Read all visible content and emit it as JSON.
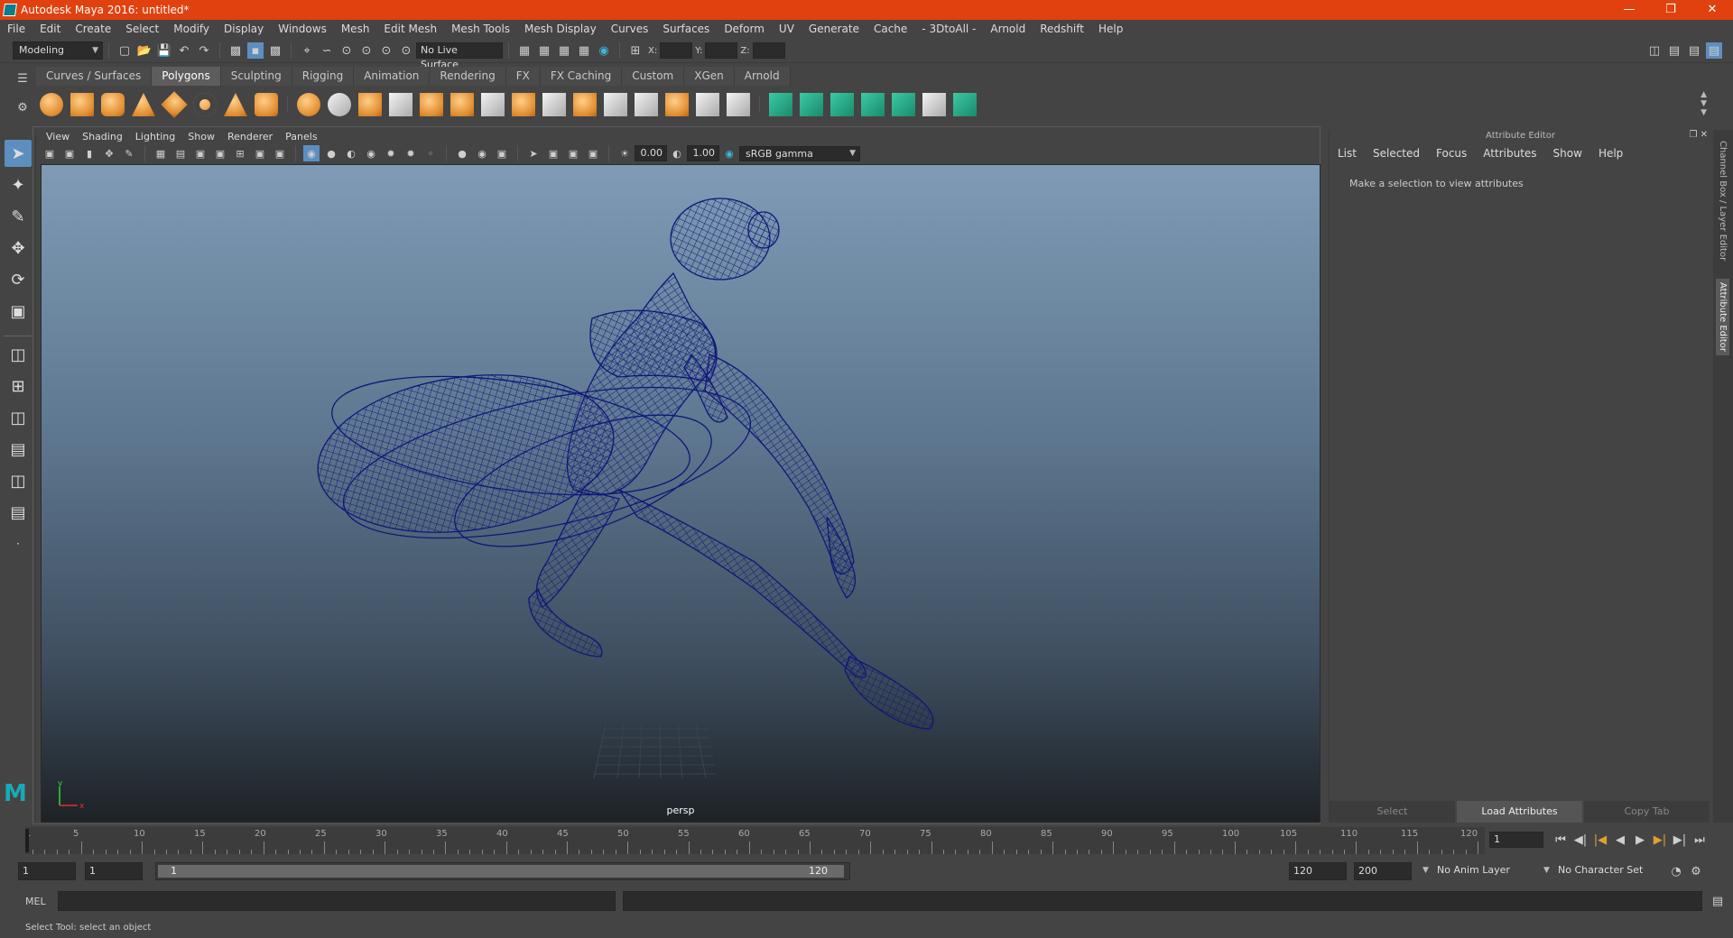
{
  "titlebar": {
    "title": "Autodesk Maya 2016: untitled*"
  },
  "menubar": {
    "items": [
      "File",
      "Edit",
      "Create",
      "Select",
      "Modify",
      "Display",
      "Windows",
      "Mesh",
      "Edit Mesh",
      "Mesh Tools",
      "Mesh Display",
      "Curves",
      "Surfaces",
      "Deform",
      "UV",
      "Generate",
      "Cache",
      "- 3DtoAll -",
      "Arnold",
      "Redshift",
      "Help"
    ]
  },
  "statusline": {
    "menuset": "Modeling",
    "live_surface": "No Live Surface",
    "x_label": "X:",
    "y_label": "Y:",
    "z_label": "Z:"
  },
  "shelf": {
    "tabs": [
      "Curves / Surfaces",
      "Polygons",
      "Sculpting",
      "Rigging",
      "Animation",
      "Rendering",
      "FX",
      "FX Caching",
      "Custom",
      "XGen",
      "Arnold"
    ],
    "active_tab": "Polygons"
  },
  "viewport": {
    "menu": [
      "View",
      "Shading",
      "Lighting",
      "Show",
      "Renderer",
      "Panels"
    ],
    "exposure": "0.00",
    "gamma": "1.00",
    "color_space": "sRGB gamma",
    "camera_label": "persp"
  },
  "attribute_editor": {
    "header": "Attribute Editor",
    "menu": [
      "List",
      "Selected",
      "Focus",
      "Attributes",
      "Show",
      "Help"
    ],
    "message": "Make a selection to view attributes",
    "buttons": {
      "select": "Select",
      "load": "Load Attributes",
      "copy": "Copy Tab"
    }
  },
  "side_tabs": {
    "channel_box": "Channel Box / Layer Editor",
    "attribute_editor": "Attribute Editor"
  },
  "timeline": {
    "labels": [
      "5",
      "10",
      "15",
      "20",
      "25",
      "30",
      "35",
      "40",
      "45",
      "50",
      "55",
      "60",
      "65",
      "70",
      "75",
      "80",
      "85",
      "90",
      "95",
      "100",
      "105",
      "110",
      "115",
      "120"
    ],
    "start_label": "1",
    "current_frame": "1"
  },
  "range": {
    "start": "1",
    "playback_start": "1",
    "slider_start": "1",
    "slider_end": "120",
    "playback_end": "120",
    "end": "200",
    "anim_layer": "No Anim Layer",
    "character_set": "No Character Set"
  },
  "cmdline": {
    "label": "MEL"
  },
  "helpline": {
    "text": "Select Tool: select an object"
  }
}
